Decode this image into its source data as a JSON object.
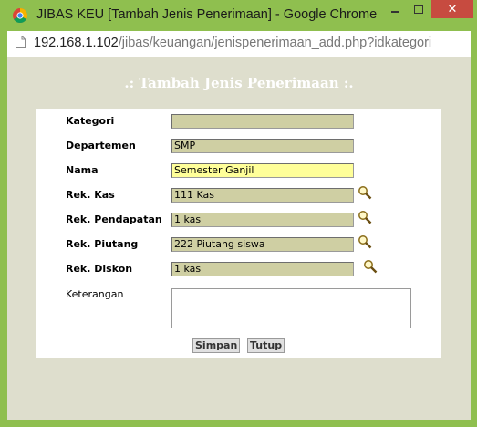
{
  "window": {
    "title": "JIBAS KEU [Tambah Jenis Penerimaan] - Google Chrome",
    "close_glyph": "✕"
  },
  "address": {
    "host": "192.168.1.102",
    "path": "/jibas/keuangan/jenispenerimaan_add.php?idkategori"
  },
  "form": {
    "heading": ".: Tambah Jenis Penerimaan :.",
    "fields": [
      {
        "label": "Kategori",
        "value": ""
      },
      {
        "label": "Departemen",
        "value": "SMP"
      },
      {
        "label": "Nama",
        "value": "Semester Ganjil"
      },
      {
        "label": "Rek. Kas",
        "value": "111 Kas"
      },
      {
        "label": "Rek. Pendapatan",
        "value": "1 kas"
      },
      {
        "label": "Rek. Piutang",
        "value": "222 Piutang siswa"
      },
      {
        "label": "Rek. Diskon",
        "value": "1 kas"
      }
    ],
    "keterangan_label": "Keterangan",
    "keterangan_value": "",
    "save_label": "Simpan",
    "close_label": "Tutup"
  },
  "icons": {
    "lookup": "magnifier-icon",
    "browser": "chrome-icon",
    "page": "page-icon"
  }
}
